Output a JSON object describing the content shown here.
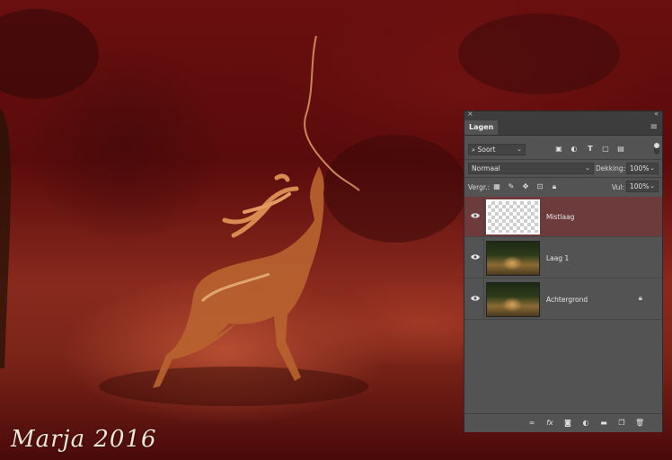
{
  "signature": "Marja 2016",
  "panel": {
    "close_glyph": "×",
    "collapse_glyph": "«",
    "tab_label": "Lagen",
    "menu_glyph": "≡",
    "filter": {
      "kind_label": "Soort",
      "kind_icon": "search-icon",
      "filter_icons": [
        "image-filter-icon",
        "adjustment-filter-icon",
        "type-filter-icon",
        "shape-filter-icon",
        "smart-object-filter-icon"
      ]
    },
    "blend_mode": "Normaal",
    "opacity_label": "Dekking:",
    "opacity_value": "100%",
    "lock_label": "Vergr.:",
    "fill_label": "Vul:",
    "fill_value": "100%",
    "layers": [
      {
        "name": "Mistlaag",
        "visible": true,
        "selected": true,
        "thumbnail": "transparent",
        "locked": false
      },
      {
        "name": "Laag 1",
        "visible": true,
        "selected": false,
        "thumbnail": "photo",
        "locked": false
      },
      {
        "name": "Achtergrond",
        "visible": true,
        "selected": false,
        "thumbnail": "photo",
        "locked": true
      }
    ],
    "bottom_icons": [
      "link-layers-icon",
      "fx-icon",
      "add-mask-icon",
      "new-adjustment-icon",
      "new-group-icon",
      "new-layer-icon",
      "delete-layer-icon"
    ],
    "fx_label": "fx"
  }
}
